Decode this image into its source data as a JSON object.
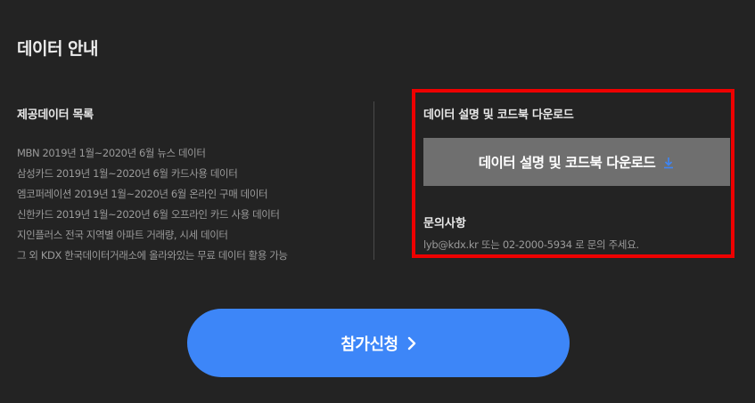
{
  "section": {
    "title": "데이터 안내"
  },
  "provided_data": {
    "title": "제공데이터 목록",
    "items": [
      "MBN 2019년 1월~2020년 6월 뉴스 데이터",
      "삼성카드 2019년 1월~2020년 6월 카드사용 데이터",
      "엠코퍼레이션 2019년 1월~2020년 6월 온라인 구매 데이터",
      "신한카드 2019년 1월~2020년 6월 오프라인 카드 사용 데이터",
      "지인플러스 전국 지역별 아파트 거래량, 시세 데이터",
      "그 외 KDX 한국데이터거래소에 올라와있는 무료 데이터 활용 가능"
    ]
  },
  "download": {
    "title": "데이터 설명 및 코드북 다운로드",
    "button_label": "데이터 설명 및 코드북 다운로드",
    "icon": "download-icon",
    "icon_color": "#3d86f8"
  },
  "inquiry": {
    "title": "문의사항",
    "text": "lyb@kdx.kr 또는 02-2000-5934 로 문의 주세요."
  },
  "apply": {
    "label": "참가신청",
    "icon": "chevron-right-icon",
    "color": "#3d86f8"
  },
  "colors": {
    "background": "#232323",
    "highlight": "#ee0000",
    "button_gray": "#6f6f6f"
  }
}
